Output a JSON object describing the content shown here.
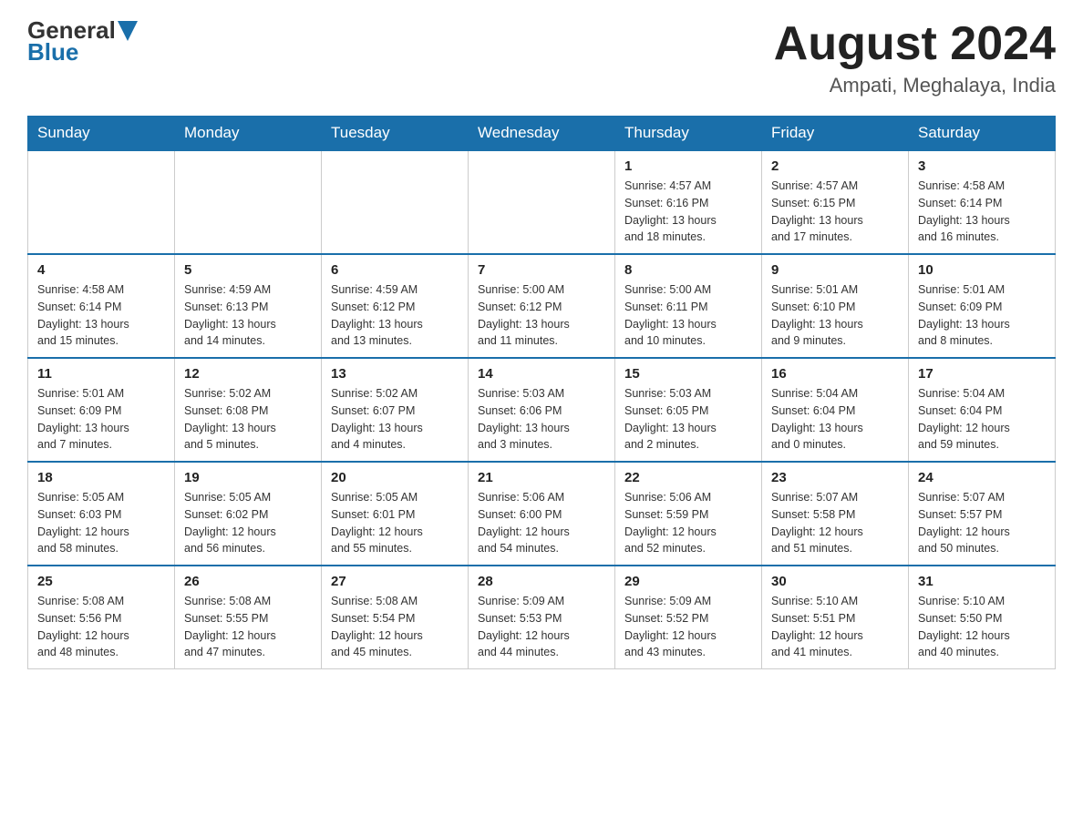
{
  "header": {
    "logo_general": "General",
    "logo_blue": "Blue",
    "month_title": "August 2024",
    "location": "Ampati, Meghalaya, India"
  },
  "days_of_week": [
    "Sunday",
    "Monday",
    "Tuesday",
    "Wednesday",
    "Thursday",
    "Friday",
    "Saturday"
  ],
  "weeks": [
    [
      {
        "day": "",
        "info": ""
      },
      {
        "day": "",
        "info": ""
      },
      {
        "day": "",
        "info": ""
      },
      {
        "day": "",
        "info": ""
      },
      {
        "day": "1",
        "info": "Sunrise: 4:57 AM\nSunset: 6:16 PM\nDaylight: 13 hours\nand 18 minutes."
      },
      {
        "day": "2",
        "info": "Sunrise: 4:57 AM\nSunset: 6:15 PM\nDaylight: 13 hours\nand 17 minutes."
      },
      {
        "day": "3",
        "info": "Sunrise: 4:58 AM\nSunset: 6:14 PM\nDaylight: 13 hours\nand 16 minutes."
      }
    ],
    [
      {
        "day": "4",
        "info": "Sunrise: 4:58 AM\nSunset: 6:14 PM\nDaylight: 13 hours\nand 15 minutes."
      },
      {
        "day": "5",
        "info": "Sunrise: 4:59 AM\nSunset: 6:13 PM\nDaylight: 13 hours\nand 14 minutes."
      },
      {
        "day": "6",
        "info": "Sunrise: 4:59 AM\nSunset: 6:12 PM\nDaylight: 13 hours\nand 13 minutes."
      },
      {
        "day": "7",
        "info": "Sunrise: 5:00 AM\nSunset: 6:12 PM\nDaylight: 13 hours\nand 11 minutes."
      },
      {
        "day": "8",
        "info": "Sunrise: 5:00 AM\nSunset: 6:11 PM\nDaylight: 13 hours\nand 10 minutes."
      },
      {
        "day": "9",
        "info": "Sunrise: 5:01 AM\nSunset: 6:10 PM\nDaylight: 13 hours\nand 9 minutes."
      },
      {
        "day": "10",
        "info": "Sunrise: 5:01 AM\nSunset: 6:09 PM\nDaylight: 13 hours\nand 8 minutes."
      }
    ],
    [
      {
        "day": "11",
        "info": "Sunrise: 5:01 AM\nSunset: 6:09 PM\nDaylight: 13 hours\nand 7 minutes."
      },
      {
        "day": "12",
        "info": "Sunrise: 5:02 AM\nSunset: 6:08 PM\nDaylight: 13 hours\nand 5 minutes."
      },
      {
        "day": "13",
        "info": "Sunrise: 5:02 AM\nSunset: 6:07 PM\nDaylight: 13 hours\nand 4 minutes."
      },
      {
        "day": "14",
        "info": "Sunrise: 5:03 AM\nSunset: 6:06 PM\nDaylight: 13 hours\nand 3 minutes."
      },
      {
        "day": "15",
        "info": "Sunrise: 5:03 AM\nSunset: 6:05 PM\nDaylight: 13 hours\nand 2 minutes."
      },
      {
        "day": "16",
        "info": "Sunrise: 5:04 AM\nSunset: 6:04 PM\nDaylight: 13 hours\nand 0 minutes."
      },
      {
        "day": "17",
        "info": "Sunrise: 5:04 AM\nSunset: 6:04 PM\nDaylight: 12 hours\nand 59 minutes."
      }
    ],
    [
      {
        "day": "18",
        "info": "Sunrise: 5:05 AM\nSunset: 6:03 PM\nDaylight: 12 hours\nand 58 minutes."
      },
      {
        "day": "19",
        "info": "Sunrise: 5:05 AM\nSunset: 6:02 PM\nDaylight: 12 hours\nand 56 minutes."
      },
      {
        "day": "20",
        "info": "Sunrise: 5:05 AM\nSunset: 6:01 PM\nDaylight: 12 hours\nand 55 minutes."
      },
      {
        "day": "21",
        "info": "Sunrise: 5:06 AM\nSunset: 6:00 PM\nDaylight: 12 hours\nand 54 minutes."
      },
      {
        "day": "22",
        "info": "Sunrise: 5:06 AM\nSunset: 5:59 PM\nDaylight: 12 hours\nand 52 minutes."
      },
      {
        "day": "23",
        "info": "Sunrise: 5:07 AM\nSunset: 5:58 PM\nDaylight: 12 hours\nand 51 minutes."
      },
      {
        "day": "24",
        "info": "Sunrise: 5:07 AM\nSunset: 5:57 PM\nDaylight: 12 hours\nand 50 minutes."
      }
    ],
    [
      {
        "day": "25",
        "info": "Sunrise: 5:08 AM\nSunset: 5:56 PM\nDaylight: 12 hours\nand 48 minutes."
      },
      {
        "day": "26",
        "info": "Sunrise: 5:08 AM\nSunset: 5:55 PM\nDaylight: 12 hours\nand 47 minutes."
      },
      {
        "day": "27",
        "info": "Sunrise: 5:08 AM\nSunset: 5:54 PM\nDaylight: 12 hours\nand 45 minutes."
      },
      {
        "day": "28",
        "info": "Sunrise: 5:09 AM\nSunset: 5:53 PM\nDaylight: 12 hours\nand 44 minutes."
      },
      {
        "day": "29",
        "info": "Sunrise: 5:09 AM\nSunset: 5:52 PM\nDaylight: 12 hours\nand 43 minutes."
      },
      {
        "day": "30",
        "info": "Sunrise: 5:10 AM\nSunset: 5:51 PM\nDaylight: 12 hours\nand 41 minutes."
      },
      {
        "day": "31",
        "info": "Sunrise: 5:10 AM\nSunset: 5:50 PM\nDaylight: 12 hours\nand 40 minutes."
      }
    ]
  ]
}
